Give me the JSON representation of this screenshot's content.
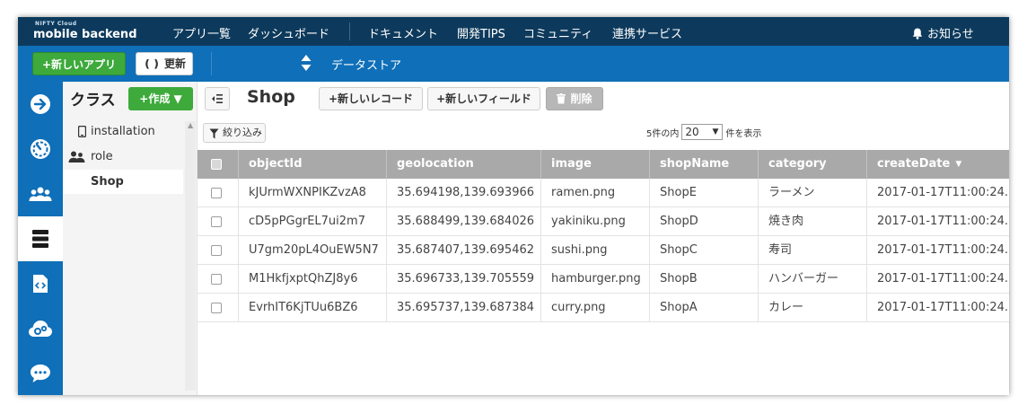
{
  "header": {
    "logo_small": "NIFTY Cloud",
    "logo_text": "mobile backend",
    "nav": [
      "アプリ一覧",
      "ダッシュボード",
      "ドキュメント",
      "開発TIPS",
      "コミュニティ",
      "連携サービス"
    ],
    "notifications_label": "お知らせ"
  },
  "toolbar": {
    "new_app_label": "+新しいアプリ",
    "refresh_label": "更新",
    "section_title": "データストア"
  },
  "rail": {
    "items": [
      "arrow-right-icon",
      "dashboard-gauge-icon",
      "users-icon",
      "datastore-icon",
      "script-icon",
      "cloud-settings-icon",
      "chat-icon"
    ],
    "active": "datastore-icon"
  },
  "class_panel": {
    "heading": "クラス",
    "create_label": "+作成 ▼",
    "items": [
      {
        "label": "installation",
        "icon": "phone-icon"
      },
      {
        "label": "role",
        "icon": "role-icon"
      },
      {
        "label": "Shop",
        "icon": ""
      }
    ],
    "selected": "Shop"
  },
  "main": {
    "class_title": "Shop",
    "new_record_label": "+新しいレコード",
    "new_field_label": "+新しいフィールド",
    "delete_label": "削除",
    "filter_label": "絞り込み",
    "pager_prefix": "5件の内",
    "page_size": "20",
    "pager_suffix": "件を表示"
  },
  "table": {
    "columns": [
      "objectId",
      "geolocation",
      "image",
      "shopName",
      "category",
      "createDate"
    ],
    "sorted_column": "createDate",
    "rows": [
      [
        "kJUrmWXNPIKZvzA8",
        "35.694198,139.693966",
        "ramen.png",
        "ShopE",
        "ラーメン",
        "2017-01-17T11:00:24."
      ],
      [
        "cD5pPGgrEL7ui2m7",
        "35.688499,139.684026",
        "yakiniku.png",
        "ShopD",
        "焼き肉",
        "2017-01-17T11:00:24."
      ],
      [
        "U7gm20pL4OuEW5N7",
        "35.687407,139.695462",
        "sushi.png",
        "ShopC",
        "寿司",
        "2017-01-17T11:00:24."
      ],
      [
        "M1HkfjxptQhZJ8y6",
        "35.696733,139.705559",
        "hamburger.png",
        "ShopB",
        "ハンバーガー",
        "2017-01-17T11:00:24."
      ],
      [
        "EvrhIT6KjTUu6BZ6",
        "35.695737,139.687384",
        "curry.png",
        "ShopA",
        "カレー",
        "2017-01-17T11:00:24."
      ]
    ]
  },
  "colors": {
    "top_bar": "#0d3a5c",
    "accent_blue": "#0f6fb8",
    "green": "#3daa3b",
    "table_header": "#a9a9a9"
  }
}
